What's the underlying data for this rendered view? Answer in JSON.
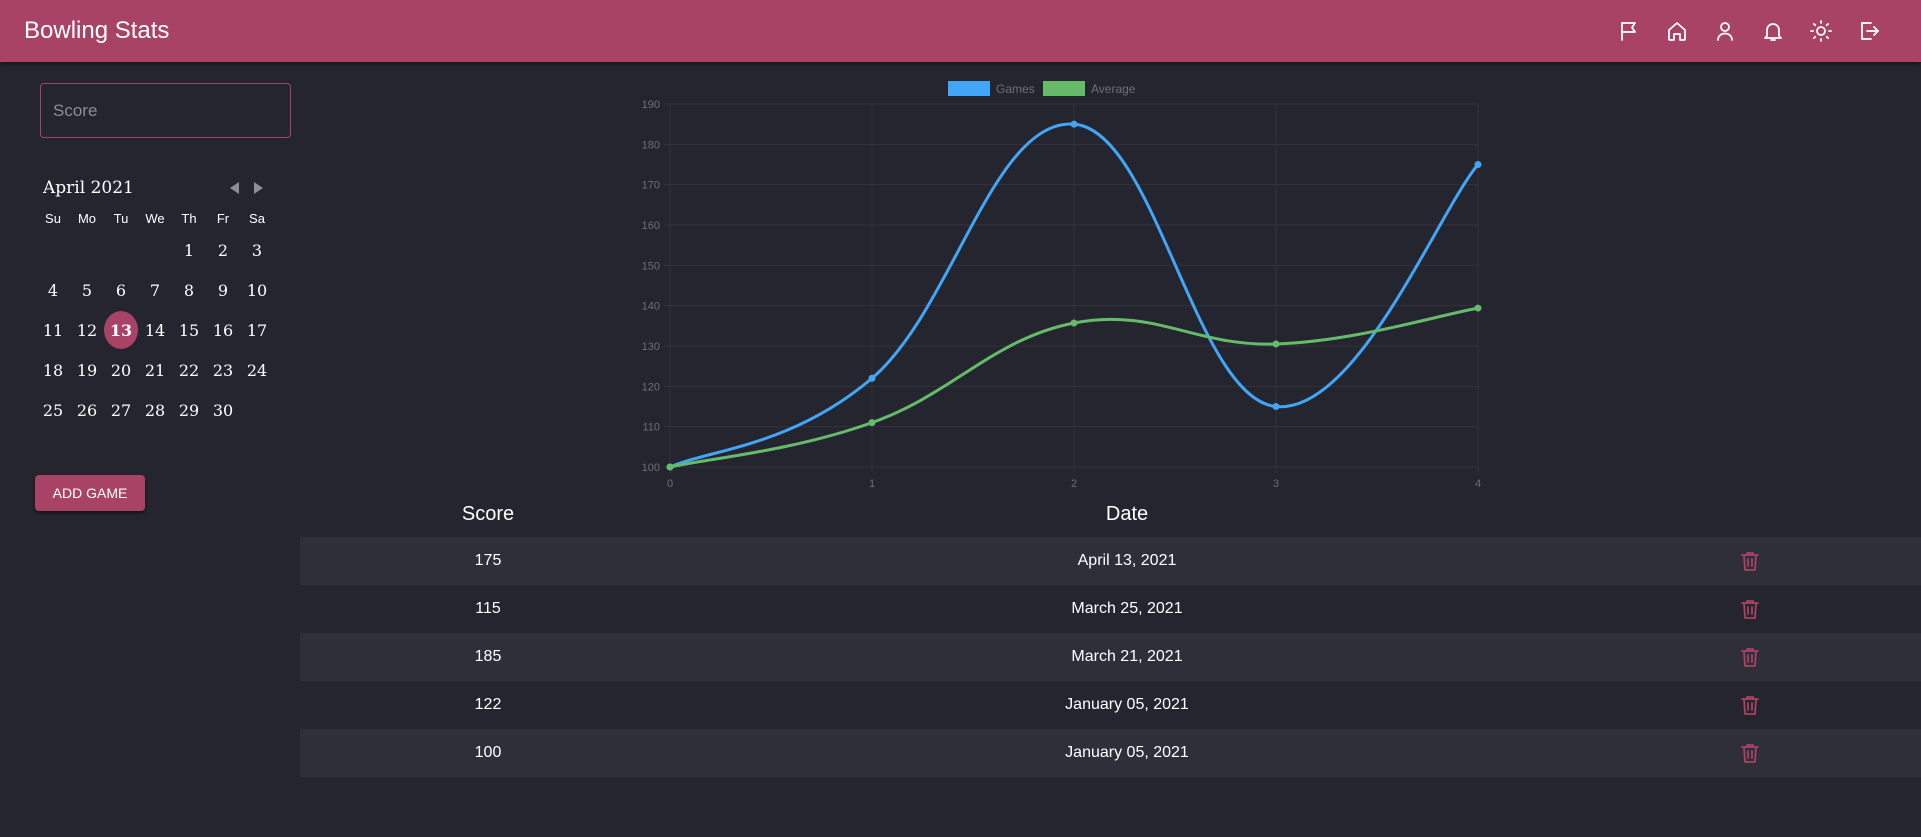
{
  "app": {
    "title": "Bowling Stats"
  },
  "appbar": {
    "icons": [
      "flag-icon",
      "home-icon",
      "user-icon",
      "bell-icon",
      "sun-icon",
      "logout-icon"
    ]
  },
  "score_input": {
    "placeholder": "Score",
    "value": ""
  },
  "calendar": {
    "month_label": "April 2021",
    "weekdays": [
      "Su",
      "Mo",
      "Tu",
      "We",
      "Th",
      "Fr",
      "Sa"
    ],
    "first_weekday_index": 4,
    "days_in_month": 30,
    "selected_day": 13
  },
  "add_game_label": "ADD GAME",
  "table": {
    "headers": {
      "score": "Score",
      "date": "Date"
    },
    "rows": [
      {
        "score": "175",
        "date": "April 13, 2021"
      },
      {
        "score": "115",
        "date": "March 25, 2021"
      },
      {
        "score": "185",
        "date": "March 21, 2021"
      },
      {
        "score": "122",
        "date": "January 05, 2021"
      },
      {
        "score": "100",
        "date": "January 05, 2021"
      }
    ]
  },
  "colors": {
    "accent": "#a84365",
    "background": "#25252f",
    "games_line": "#42a5f5",
    "average_line": "#66bb6a"
  },
  "chart_data": {
    "type": "line",
    "x": [
      0,
      1,
      2,
      3,
      4
    ],
    "series": [
      {
        "name": "Games",
        "values": [
          100,
          122,
          185,
          115,
          175
        ],
        "color": "#42a5f5"
      },
      {
        "name": "Average",
        "values": [
          100,
          111,
          135.7,
          130.5,
          139.4
        ],
        "color": "#66bb6a"
      }
    ],
    "ylim": [
      100,
      190
    ],
    "yticks": [
      100,
      110,
      120,
      130,
      140,
      150,
      160,
      170,
      180,
      190
    ],
    "xticks": [
      0,
      1,
      2,
      3,
      4
    ],
    "grid": true,
    "legend": "top-center"
  }
}
